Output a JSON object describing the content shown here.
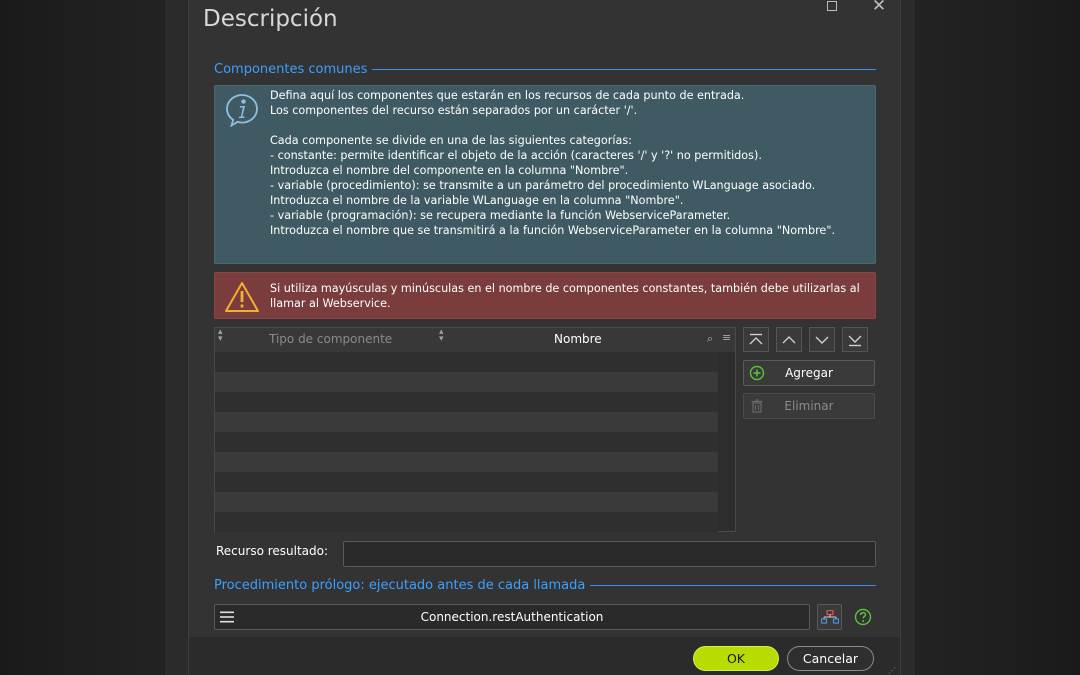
{
  "dialog": {
    "title": "Descripción"
  },
  "common_section": {
    "label": "Componentes comunes"
  },
  "info": {
    "text": "Defina aquí los componentes que estarán en los recursos de cada punto de entrada.\nLos componentes del recurso están separados por un carácter '/'.\n\nCada componente se divide en una de las siguientes categorías:\n- constante: permite identificar el objeto de la acción (caracteres '/' y '?' no permitidos).\nIntroduzca el nombre del componente en la columna \"Nombre\".\n- variable (procedimiento): se transmite a un parámetro del procedimiento WLanguage asociado.\nIntroduzca el nombre de la variable WLanguage en la columna \"Nombre\".\n- variable (programación): se recupera mediante la función WebserviceParameter.\nIntroduzca el nombre que se transmitirá a la función WebserviceParameter en la columna \"Nombre\"."
  },
  "warning": {
    "text": "Si utiliza mayúsculas y minúsculas en el nombre de componentes constantes, también debe utilizarlas al llamar al Webservice."
  },
  "table": {
    "columns": [
      "Tipo de componente",
      "Nombre"
    ],
    "rows": []
  },
  "actions": {
    "add_label": "Agregar",
    "delete_label": "Eliminar"
  },
  "result": {
    "label": "Recurso resultado:",
    "value": ""
  },
  "prologue_section": {
    "label": "Procedimiento prólogo: ejecutado antes de cada llamada"
  },
  "prologue": {
    "value": "Connection.restAuthentication"
  },
  "footer": {
    "ok_label": "OK",
    "cancel_label": "Cancelar"
  },
  "colors": {
    "accent": "#3aa0ff",
    "ok_button": "#b8dc00",
    "info_bg": "#3f5a62",
    "warning_bg": "#7a3c3c",
    "add_icon": "#5cc23a",
    "help_icon": "#5cc23a"
  },
  "icons": {
    "info": "info-speech-bubble-icon",
    "warning": "warning-triangle-icon",
    "move_top": "move-to-top-icon",
    "move_up": "chevron-up-icon",
    "move_down": "chevron-down-icon",
    "move_bottom": "move-to-bottom-icon",
    "add": "plus-circle-icon",
    "delete": "trash-icon",
    "menu": "hamburger-menu-icon",
    "edit_procedure": "procedure-graph-icon",
    "help": "help-icon"
  }
}
